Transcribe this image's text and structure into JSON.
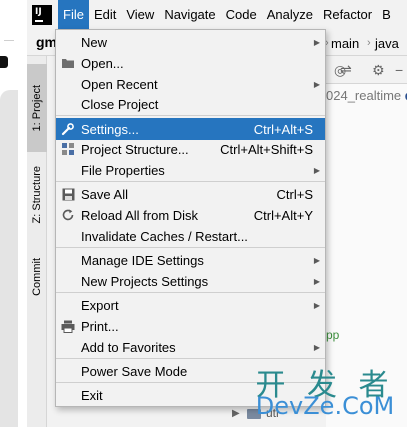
{
  "menubar": {
    "items": [
      {
        "label": "File"
      },
      {
        "label": "Edit"
      },
      {
        "label": "View"
      },
      {
        "label": "Navigate"
      },
      {
        "label": "Code"
      },
      {
        "label": "Analyze"
      },
      {
        "label": "Refactor"
      },
      {
        "label": "B"
      }
    ]
  },
  "toolbar": {
    "project_name_fragment": "gm",
    "breadcrumb_main": "main",
    "breadcrumb_java": "java"
  },
  "side_tabs": {
    "project": "1: Project",
    "structure": "Z: Structure",
    "commit": "Commit"
  },
  "background": {
    "path_prefix": "024_realtime",
    "path_suffix": "d",
    "green_fragment": "pp",
    "bottom_label": "utl"
  },
  "file_menu": {
    "items": [
      {
        "label": "New",
        "shortcut": "",
        "submenu": true,
        "icon": ""
      },
      {
        "label": "Open...",
        "shortcut": "",
        "submenu": false,
        "icon": "folder-icon"
      },
      {
        "label": "Open Recent",
        "shortcut": "",
        "submenu": true,
        "icon": ""
      },
      {
        "label": "Close Project",
        "shortcut": "",
        "submenu": false,
        "icon": ""
      },
      {
        "label": "Settings...",
        "shortcut": "Ctrl+Alt+S",
        "submenu": false,
        "icon": "wrench-icon"
      },
      {
        "label": "Project Structure...",
        "shortcut": "Ctrl+Alt+Shift+S",
        "submenu": false,
        "icon": "project-structure-icon"
      },
      {
        "label": "File Properties",
        "shortcut": "",
        "submenu": true,
        "icon": ""
      },
      {
        "label": "Save All",
        "shortcut": "Ctrl+S",
        "submenu": false,
        "icon": "save-icon"
      },
      {
        "label": "Reload All from Disk",
        "shortcut": "Ctrl+Alt+Y",
        "submenu": false,
        "icon": "reload-icon"
      },
      {
        "label": "Invalidate Caches / Restart...",
        "shortcut": "",
        "submenu": false,
        "icon": ""
      },
      {
        "label": "Manage IDE Settings",
        "shortcut": "",
        "submenu": true,
        "icon": ""
      },
      {
        "label": "New Projects Settings",
        "shortcut": "",
        "submenu": true,
        "icon": ""
      },
      {
        "label": "Export",
        "shortcut": "",
        "submenu": true,
        "icon": ""
      },
      {
        "label": "Print...",
        "shortcut": "",
        "submenu": false,
        "icon": "print-icon"
      },
      {
        "label": "Add to Favorites",
        "shortcut": "",
        "submenu": true,
        "icon": ""
      },
      {
        "label": "Power Save Mode",
        "shortcut": "",
        "submenu": false,
        "icon": ""
      },
      {
        "label": "Exit",
        "shortcut": "",
        "submenu": false,
        "icon": ""
      }
    ],
    "highlighted_index": 4
  },
  "watermark": {
    "line1": "开 发 者",
    "line2": "DevZe.CoM"
  },
  "colors": {
    "accent": "#2675bf",
    "menu_bg": "#f2f2f2",
    "watermark_top": "#2a8a8e",
    "watermark_bottom": "#3b8fd6"
  }
}
